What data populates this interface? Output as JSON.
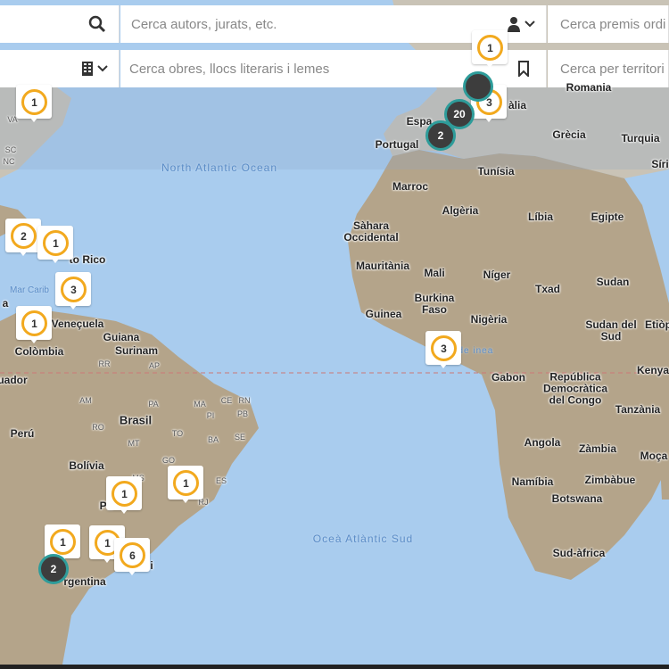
{
  "search": {
    "authors_placeholder": "Cerca autors, jurats, etc.",
    "awards_placeholder": "Cerca premis ordi",
    "works_placeholder": "Cerca obres, llocs literaris i lemes",
    "territory_placeholder": "Cerca per territori"
  },
  "oceans": {
    "north_atlantic": "North Atlantic Ocean",
    "south_atlantic": "Oceà Atlàntic Sud",
    "caribbean": "Mar Carib",
    "gulf_guinea": "lf de inea"
  },
  "places": {
    "espanya": "Espa",
    "portugal": "Portugal",
    "italia": "àlia",
    "romania": "Romania",
    "grecia": "Grècia",
    "turquia": "Turquia",
    "siria": "Síri",
    "marroc": "Marroc",
    "tunisia": "Tunísia",
    "algeria": "Algèria",
    "libia": "Líbia",
    "egipte": "Egipte",
    "sahara": "Sàhara Occidental",
    "mauritania": "Mauritània",
    "mali": "Mali",
    "niger": "Níger",
    "txad": "Txad",
    "sudan": "Sudan",
    "burkina": "Burkina Faso",
    "guinea": "Guinea",
    "nigeria": "Nigèria",
    "sudan_sud": "Sudan del Sud",
    "etiopia": "Etiòp",
    "kenya": "Kenya",
    "gabon": "Gabon",
    "rdc": "República Democràtica del Congo",
    "tanzania": "Tanzània",
    "angola": "Angola",
    "zambia": "Zàmbia",
    "mocambic": "Moça",
    "namibia": "Namíbia",
    "zimbabue": "Zimbàbue",
    "botswana": "Botswana",
    "sud_africa": "Sud-àfrica",
    "puerto_rico": "to Rico",
    "venezuela": "Veneçuela",
    "guyana": "Guiana",
    "surinam": "Surinam",
    "colombia": "Colòmbia",
    "equador": "uador",
    "brasil": "Brasil",
    "peru": "Perú",
    "bolivia": "Bolívia",
    "paraguai": "Pa",
    "argentina": "rgentina",
    "la": "a",
    "rr": "RR",
    "ap": "AP",
    "am": "AM",
    "pa": "PA",
    "ma": "MA",
    "ce": "CE",
    "rn": "RN",
    "pb": "PB",
    "pi": "PI",
    "to": "TO",
    "mt": "MT",
    "ba": "BA",
    "se": "SE",
    "ro": "RO",
    "go": "GO",
    "es": "ES",
    "rj": "RJ",
    "ms": "MS",
    "nc": "NC",
    "va": "VA",
    "sc": "SC",
    "gu": "u",
    "i": "i"
  },
  "markers": [
    {
      "count": "1"
    },
    {
      "count": "2"
    },
    {
      "count": "1"
    },
    {
      "count": "3"
    },
    {
      "count": "1"
    },
    {
      "count": "3"
    },
    {
      "count": "1"
    },
    {
      "count": "1"
    },
    {
      "count": "1"
    },
    {
      "count": "1"
    },
    {
      "count": "6"
    },
    {
      "count": "3"
    },
    {
      "count": "1"
    }
  ],
  "clusters": [
    {
      "count": "20"
    },
    {
      "count": "2"
    },
    {
      "count": "2"
    }
  ],
  "colors": {
    "ocean": "#a9ccee",
    "land": "#b4a48a",
    "marker_ring": "#f2a91e",
    "cluster_ring": "#2e9c9a",
    "cluster_fill": "#3d3d3d"
  }
}
